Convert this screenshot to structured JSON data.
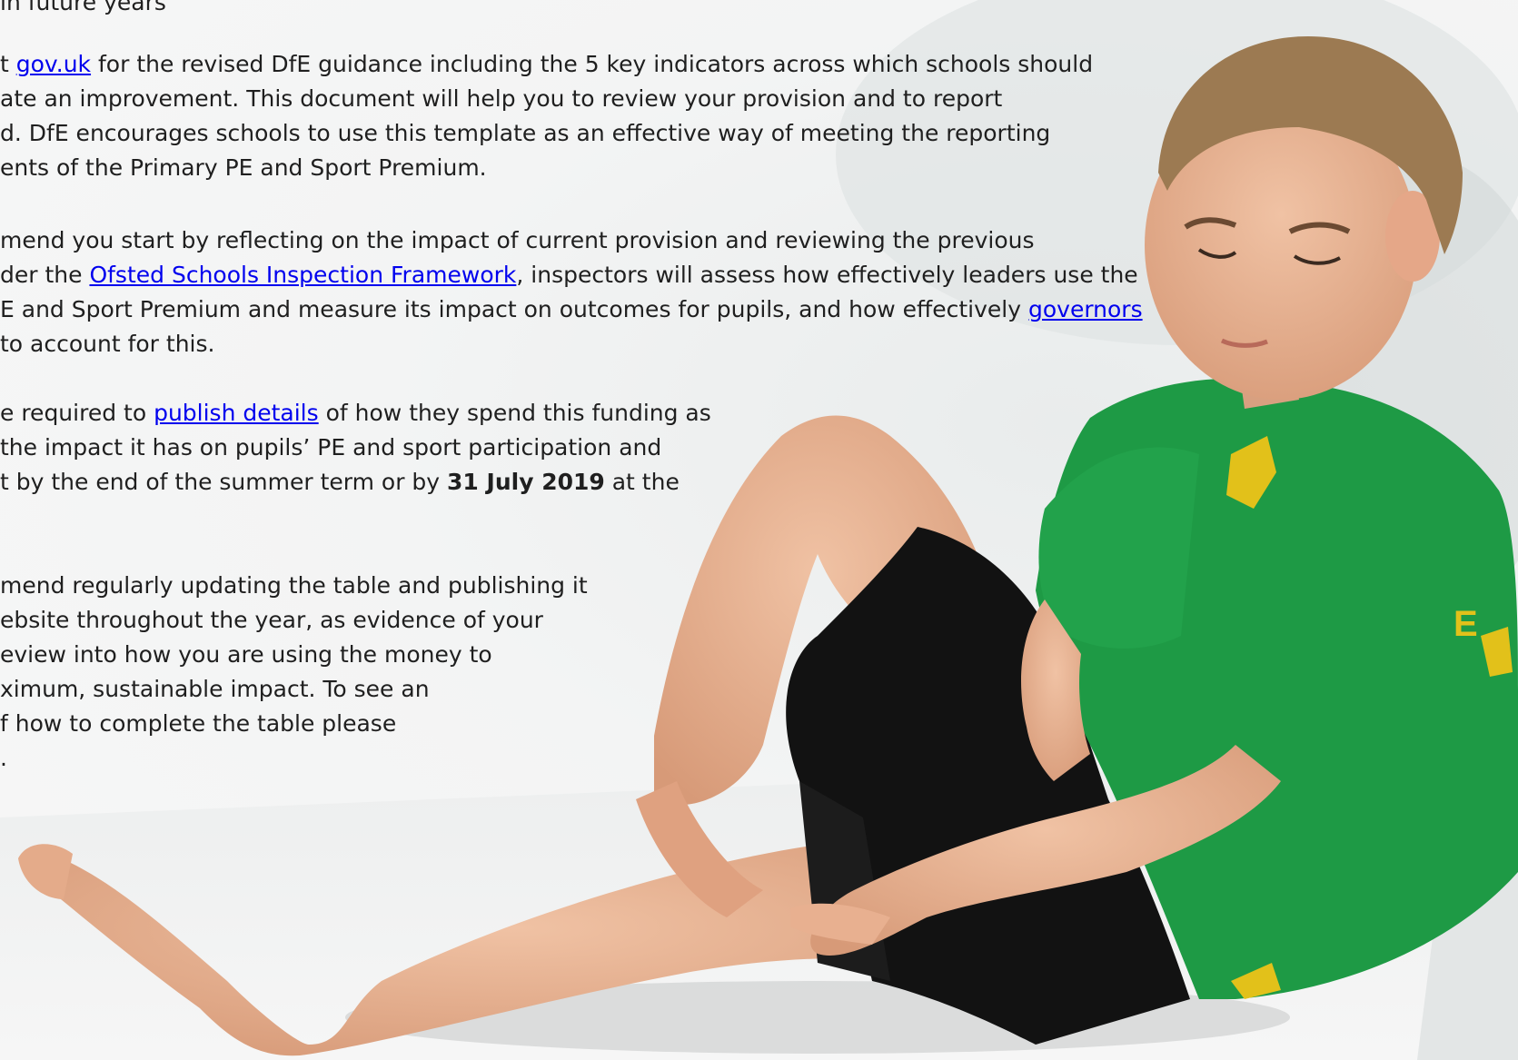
{
  "document": {
    "lines": [
      {
        "text": " in future years"
      },
      {
        "pre": "t ",
        "link": "gov.uk",
        "post": " for the revised DfE guidance including the 5 key indicators across which schools should"
      },
      {
        "text": "ate an improvement. This document will help you to review your provision and to report"
      },
      {
        "text": "d. DfE encourages schools to use this template as an effective way of meeting the reporting"
      },
      {
        "text": "ents of the Primary PE and Sport Premium."
      },
      {
        "text": "mend you start by reflecting on the impact of current provision and reviewing the previous"
      },
      {
        "pre": "der the ",
        "link": "Ofsted Schools Inspection Framework",
        "post": ", inspectors will assess how effectively leaders use the"
      },
      {
        "pre": "E and Sport Premium and measure its impact on outcomes for pupils, and how effectively ",
        "link": "governors",
        "post": ""
      },
      {
        "text": " to account for this."
      },
      {
        "pre": "e required to ",
        "link": "publish details",
        "post": " of how they spend this funding as"
      },
      {
        "text": " the impact it has on pupils’ PE and sport participation and"
      },
      {
        "pre": "t by the end of the summer term or by ",
        "bold": "31 July 2019",
        "post": " at the"
      },
      {
        "text": "mend regularly updating the table and publishing it"
      },
      {
        "text": "ebsite throughout the year, as evidence of your"
      },
      {
        "text": "eview into how you are using the money to"
      },
      {
        "text": "ximum, sustainable impact. To see an"
      },
      {
        "text": "f how to complete the table please"
      },
      {
        "text": "."
      }
    ]
  },
  "photo": {
    "shirt_letter_1": "E",
    "colors": {
      "shirt": "#1e9a45",
      "shorts": "#121212",
      "skin": "#e8b090",
      "hair": "#9c7a52",
      "emblem": "#e2c11a"
    }
  }
}
